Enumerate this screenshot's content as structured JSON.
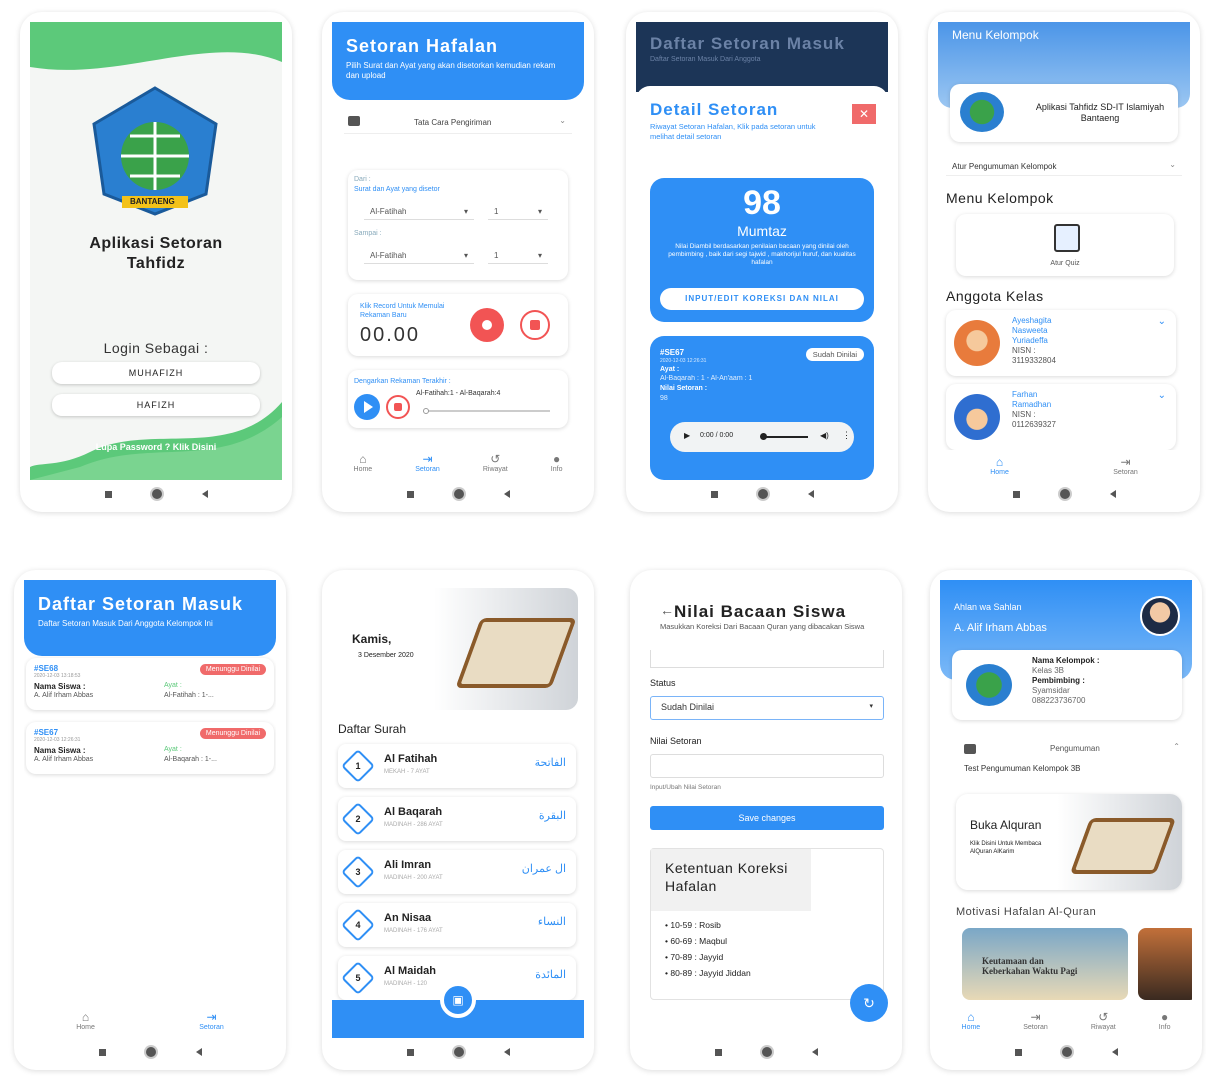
{
  "p1": {
    "title": "Aplikasi Setoran Tahfidz",
    "login_label": "Login Sebagai :",
    "btn1": "MUHAFIZH",
    "btn2": "HAFIZH",
    "forgot": "Lupa Password ? Klik Disini",
    "logo_text": "BANTAENG"
  },
  "p2": {
    "title": "Setoran Hafalan",
    "subtitle": "Pilih Surat dan Ayat yang akan disetorkan kemudian rekam dan upload",
    "howto": "Tata Cara Pengiriman",
    "dari": "Dari :",
    "dari_sub": "Surat dan Ayat yang disetor",
    "surat1": "Al-Fatihah",
    "ayat1": "1",
    "sampai": "Sampai :",
    "surat2": "Al-Fatihah",
    "ayat2": "1",
    "rec_hint": "Klik Record Untuk Memulai Rekaman Baru",
    "timer": "00.00",
    "listen": "Dengarkan Rekaman Terakhir :",
    "track": "Al-Fatihah:1 - Al-Baqarah:4",
    "nav": [
      "Home",
      "Setoran",
      "Riwayat",
      "Info"
    ]
  },
  "p3": {
    "bg_title": "Daftar Setoran Masuk",
    "bg_sub": "Daftar Setoran Masuk Dari Anggota",
    "title": "Detail Setoran",
    "subtitle": "Riwayat Setoran Hafalan, Klik pada setoran untuk melihat detail setoran",
    "score": "98",
    "grade": "Mumtaz",
    "note": "Nilai Diambil berdasarkan penilaian bacaan yang dinilai oleh pembimbing , baik dari segi tajwid , makhorijul huruf, dan kualitas hafalan",
    "btn": "INPUT/EDIT KOREKSI DAN NILAI",
    "id": "#SE67",
    "date": "2020-12-03 12:26:31",
    "badge": "Sudah Dinilai",
    "ayat_l": "Ayat :",
    "ayat_v": "Al-Baqarah : 1 - Al-An'aam : 1",
    "nilai_l": "Nilai Setoran :",
    "nilai_v": "98",
    "audio_time": "0:00 / 0:00"
  },
  "p4": {
    "header": "Menu Kelompok",
    "app_name": "Aplikasi Tahfidz SD-IT Islamiyah Bantaeng",
    "atur": "Atur Pengumuman Kelompok",
    "menu": "Menu Kelompok",
    "quiz": "Atur Quiz",
    "anggota": "Anggota Kelas",
    "m1_name": "Ayeshagita Nasweeta Yuriadeffa",
    "m1_nisn": "NISN :",
    "m1_no": "3119332804",
    "m2_name": "Farhan Ramadhan",
    "m2_nisn": "NISN :",
    "m2_no": "0112639327",
    "nav": [
      "Home",
      "Setoran"
    ]
  },
  "p5": {
    "title": "Daftar Setoran Masuk",
    "subtitle": "Daftar Setoran Masuk Dari Anggota Kelompok Ini",
    "items": [
      {
        "id": "#SE68",
        "date": "2020-12-03 13:18:53",
        "badge": "Menunggu Dinilai",
        "nama_l": "Nama Siswa :",
        "nama": "A. Alif Irham Abbas",
        "ayat_l": "Ayat :",
        "ayat": "Al-Fatihah : 1-..."
      },
      {
        "id": "#SE67",
        "date": "2020-12-03 12:26:31",
        "badge": "Menunggu Dinilai",
        "nama_l": "Nama Siswa :",
        "nama": "A. Alif Irham Abbas",
        "ayat_l": "Ayat :",
        "ayat": "Al-Baqarah : 1-..."
      }
    ],
    "nav": [
      "Home",
      "Setoran"
    ]
  },
  "p6": {
    "day": "Kamis,",
    "date": "3 Desember 2020",
    "list_title": "Daftar Surah",
    "surahs": [
      {
        "n": "1",
        "name": "Al Fatihah",
        "sub": "MEKAH - 7 AYAT",
        "ar": "الفاتحة"
      },
      {
        "n": "2",
        "name": "Al Baqarah",
        "sub": "MADINAH - 286 AYAT",
        "ar": "البقرة"
      },
      {
        "n": "3",
        "name": "Ali Imran",
        "sub": "MADINAH - 200 AYAT",
        "ar": "ال عمران"
      },
      {
        "n": "4",
        "name": "An Nisaa",
        "sub": "MADINAH - 176 AYAT",
        "ar": "النساء"
      },
      {
        "n": "5",
        "name": "Al Maidah",
        "sub": "MADINAH - 120",
        "ar": "المائدة"
      }
    ]
  },
  "p7": {
    "title": "Nilai Bacaan Siswa",
    "subtitle": "Masukkan Koreksi Dari Bacaan Quran yang dibacakan Siswa",
    "status_l": "Status",
    "status_v": "Sudah Dinilai",
    "nilai_l": "Nilai Setoran",
    "hint": "Input/Ubah Nilai Setoran",
    "save": "Save changes",
    "rules_title": "Ketentuan Koreksi Hafalan",
    "rules": [
      "10-59 : Rosib",
      "60-69 : Maqbul",
      "70-89 : Jayyid",
      "80-89 : Jayyid Jiddan"
    ]
  },
  "p8": {
    "greet": "Ahlan wa Sahlan",
    "name": "A. Alif Irham Abbas",
    "kel_l": "Nama Kelompok :",
    "kel_v": "Kelas 3B",
    "pem_l": "Pembimbing :",
    "pem_v": "Syamsidar",
    "phone": "088223736700",
    "peng": "Pengumuman",
    "peng_text": "Test Pengumuman Kelompok 3B",
    "buka": "Buka Alquran",
    "buka_sub": "Klik Disini Untuk Membaca AlQuran AlKarim",
    "motivasi": "Motivasi Hafalan Al-Quran",
    "img_text": "Keutamaan dan Keberkahan Waktu Pagi",
    "nav": [
      "Home",
      "Setoran",
      "Riwayat",
      "Info"
    ]
  },
  "colors": {
    "accent": "#2f8ff5",
    "green": "#5cc97a",
    "red": "#f06a6a"
  }
}
